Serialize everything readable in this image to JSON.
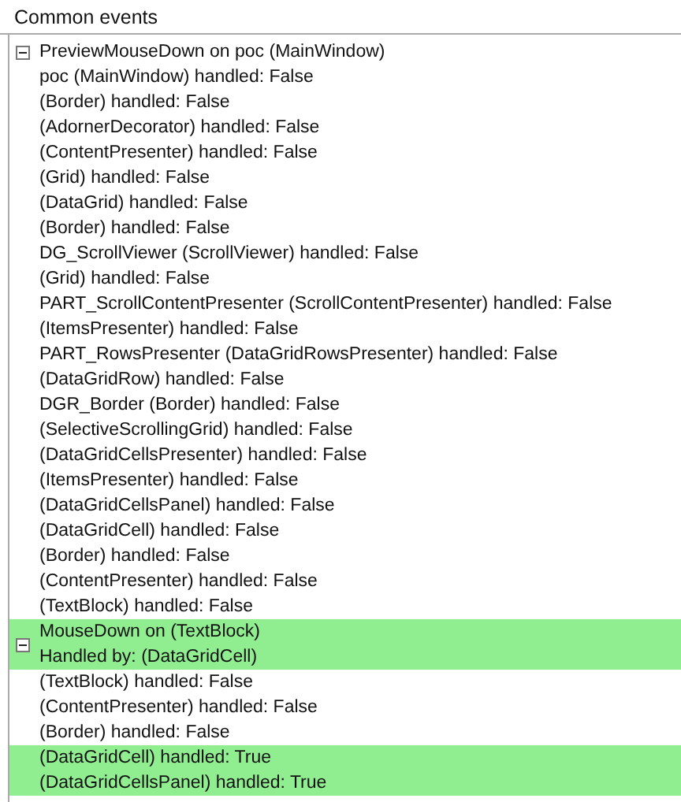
{
  "panel": {
    "title": "Common events"
  },
  "groups": [
    {
      "title": "PreviewMouseDown on poc (MainWindow)",
      "handled": false,
      "expanded": true,
      "children": [
        {
          "text": "poc (MainWindow) handled: False",
          "handled": false
        },
        {
          "text": "(Border) handled: False",
          "handled": false
        },
        {
          "text": "(AdornerDecorator) handled: False",
          "handled": false
        },
        {
          "text": "(ContentPresenter) handled: False",
          "handled": false
        },
        {
          "text": "(Grid) handled: False",
          "handled": false
        },
        {
          "text": "(DataGrid) handled: False",
          "handled": false
        },
        {
          "text": "(Border) handled: False",
          "handled": false
        },
        {
          "text": "DG_ScrollViewer (ScrollViewer) handled: False",
          "handled": false
        },
        {
          "text": "(Grid) handled: False",
          "handled": false
        },
        {
          "text": "PART_ScrollContentPresenter (ScrollContentPresenter) handled: False",
          "handled": false
        },
        {
          "text": "(ItemsPresenter) handled: False",
          "handled": false
        },
        {
          "text": "PART_RowsPresenter (DataGridRowsPresenter) handled: False",
          "handled": false
        },
        {
          "text": "(DataGridRow) handled: False",
          "handled": false
        },
        {
          "text": "DGR_Border (Border) handled: False",
          "handled": false
        },
        {
          "text": "(SelectiveScrollingGrid) handled: False",
          "handled": false
        },
        {
          "text": "(DataGridCellsPresenter) handled: False",
          "handled": false
        },
        {
          "text": "(ItemsPresenter) handled: False",
          "handled": false
        },
        {
          "text": "(DataGridCellsPanel) handled: False",
          "handled": false
        },
        {
          "text": "(DataGridCell) handled: False",
          "handled": false
        },
        {
          "text": "(Border) handled: False",
          "handled": false
        },
        {
          "text": "(ContentPresenter) handled: False",
          "handled": false
        },
        {
          "text": "(TextBlock) handled: False",
          "handled": false
        }
      ]
    },
    {
      "title": "MouseDown on (TextBlock)",
      "subtitle": "Handled by: (DataGridCell)",
      "handled": true,
      "expanded": true,
      "children": [
        {
          "text": "(TextBlock) handled: False",
          "handled": false
        },
        {
          "text": "(ContentPresenter) handled: False",
          "handled": false
        },
        {
          "text": "(Border) handled: False",
          "handled": false
        },
        {
          "text": "(DataGridCell) handled: True",
          "handled": true
        },
        {
          "text": "(DataGridCellsPanel) handled: True",
          "handled": true
        }
      ]
    }
  ]
}
